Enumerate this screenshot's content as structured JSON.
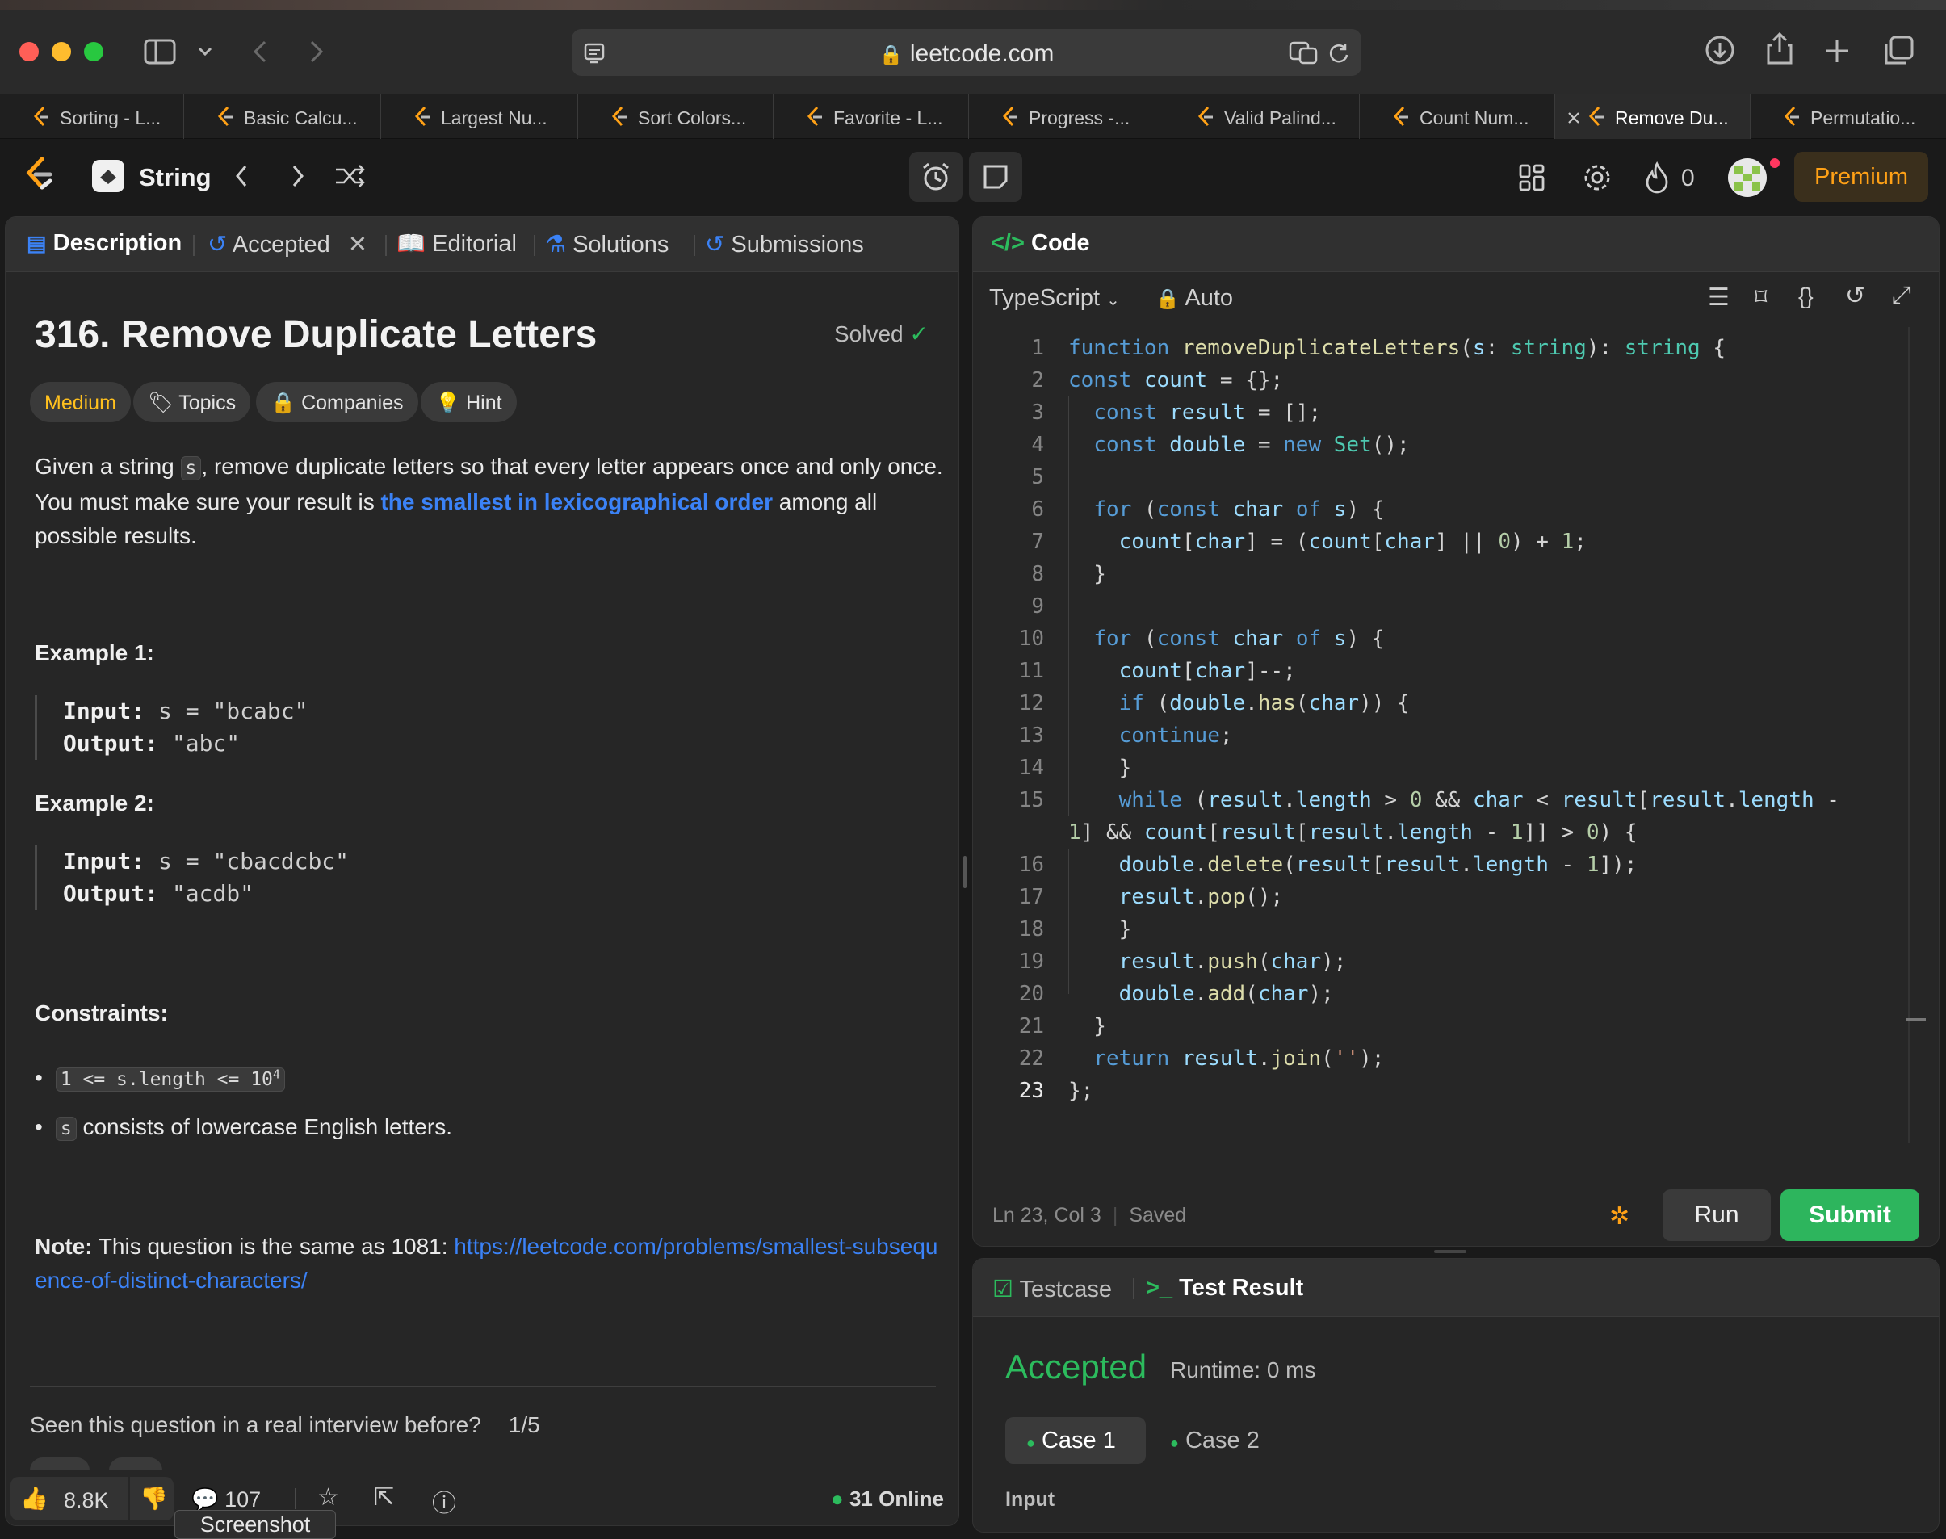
{
  "browser": {
    "url": "leetcode.com",
    "tabs": [
      {
        "label": "Sorting - L..."
      },
      {
        "label": "Basic Calcu..."
      },
      {
        "label": "Largest Nu..."
      },
      {
        "label": "Sort Colors..."
      },
      {
        "label": "Favorite - L..."
      },
      {
        "label": "Progress -..."
      },
      {
        "label": "Valid Palind..."
      },
      {
        "label": "Count Num..."
      },
      {
        "label": "Remove Du..."
      },
      {
        "label": "Permutatio..."
      }
    ]
  },
  "header": {
    "list_name": "String",
    "streak": "0",
    "premium": "Premium"
  },
  "left_tabs": {
    "description": "Description",
    "accepted": "Accepted",
    "editorial": "Editorial",
    "solutions": "Solutions",
    "submissions": "Submissions"
  },
  "problem": {
    "title": "316. Remove Duplicate Letters",
    "status": "Solved",
    "difficulty": "Medium",
    "topics": "Topics",
    "companies": "Companies",
    "hint": "Hint",
    "desc_1": "Given a string ",
    "desc_code": "s",
    "desc_2": ", remove duplicate letters so that every letter appears once and only once. You must make sure your result is ",
    "desc_link": "the smallest in lexicographical order",
    "desc_3": " among all possible results.",
    "examples": [
      {
        "heading": "Example 1:",
        "input_label": "Input:",
        "input": " s = \"bcabc\"",
        "output_label": "Output:",
        "output": " \"abc\""
      },
      {
        "heading": "Example 2:",
        "input_label": "Input:",
        "input": " s = \"cbacdcbc\"",
        "output_label": "Output:",
        "output": " \"acdb\""
      }
    ],
    "constraints_heading": "Constraints:",
    "constraint_1": "1 <= s.length <= 10",
    "constraint_1_sup": "4",
    "constraint_2_code": "s",
    "constraint_2": " consists of lowercase English letters.",
    "note_label": "Note:",
    "note_text": " This question is the same as 1081: ",
    "note_link": "https://leetcode.com/problems/smallest-subsequence-of-distinct-characters/",
    "interview_q": "Seen this question in a real interview before?",
    "interview_page": "1/5"
  },
  "footer": {
    "likes": "8.8K",
    "comments": "107",
    "online": "31 Online",
    "tooltip": "Screenshot"
  },
  "code": {
    "panel_title": "Code",
    "language": "TypeScript",
    "mode": "Auto",
    "status_pos": "Ln 23, Col 3",
    "status_saved": "Saved",
    "run": "Run",
    "submit": "Submit"
  },
  "result": {
    "tab_testcase": "Testcase",
    "tab_result": "Test Result",
    "verdict": "Accepted",
    "runtime": "Runtime: 0 ms",
    "case1": "Case 1",
    "case2": "Case 2",
    "input_label": "Input"
  },
  "colors": {
    "accent_orange": "#ffa116",
    "accepted_green": "#2cbb5d",
    "submit_green": "#2db55d",
    "medium_yellow": "#ffc01e",
    "link_blue": "#3b82f6"
  }
}
